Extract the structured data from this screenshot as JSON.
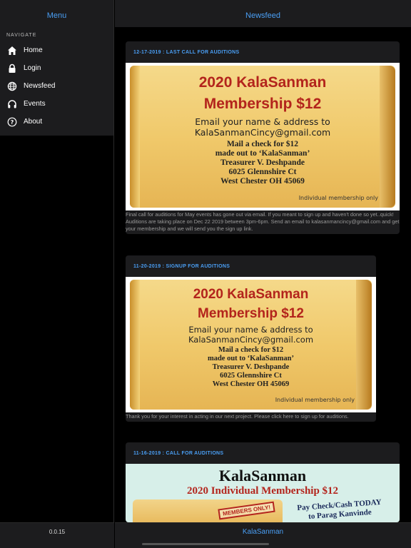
{
  "status_bar": {
    "left": "",
    "right": ""
  },
  "menu": {
    "title": "Menu",
    "nav_heading": "NAVIGATE",
    "items": [
      {
        "label": "Home",
        "icon": "home-icon"
      },
      {
        "label": "Login",
        "icon": "lock-icon"
      },
      {
        "label": "Newsfeed",
        "icon": "globe-icon"
      },
      {
        "label": "Events",
        "icon": "headphones-icon"
      },
      {
        "label": "About",
        "icon": "question-icon"
      }
    ],
    "version": "0.0.15"
  },
  "feed": {
    "title": "Newsfeed",
    "footer": "KalaSanman",
    "posts": [
      {
        "heading": "12-17-2019 : LAST CALL FOR AUDITIONS",
        "body": "Final call for auditions for May events has gone out via email. If you meant to sign up and haven't done so yet..quick! Auditions are taking place on Dec 22 2019 between 3pm-6pm. Send an email to kalasanmancincy@gmail.com and get your membership and we will send you the sign up link.",
        "poster": {
          "line1": "2020 KalaSanman",
          "line2": "Membership $12",
          "line3": "Email your name & address to",
          "line4": "KalaSanmanCincy@gmail.com",
          "line5": "Mail a check for $12",
          "line6": "made out to ‘KalaSanman’",
          "line7": "Treasurer V. Deshpande",
          "line8": "6025 Glennshire Ct",
          "line9": "West Chester OH 45069",
          "note": "Individual membership only"
        }
      },
      {
        "heading": "11-20-2019 : SIGNUP FOR AUDITIONS",
        "body": "Thank you for your interest in acting in our next project. Please click here to sign up for auditions.",
        "poster": {
          "line1": "2020 KalaSanman",
          "line2": "Membership $12",
          "line3": "Email your name & address to",
          "line4": "KalaSanmanCincy@gmail.com",
          "line5": "Mail a check for $12",
          "line6": "made out to ‘KalaSanman’",
          "line7": "Treasurer V. Deshpande",
          "line8": "6025 Glennshire Ct",
          "line9": "West Chester OH 45069",
          "note": "Individual membership only"
        }
      },
      {
        "heading": "11-16-2019 : CALL FOR AUDITIONS",
        "poster": {
          "name": "KalaSanman",
          "subtitle": "2020 Individual Membership $12",
          "stamp": "MEMBERS ONLY!",
          "pay1": "Pay Check/Cash TODAY",
          "pay2": "to Parag Kanvinde"
        }
      }
    ]
  },
  "colors": {
    "accent": "#4a9ff5",
    "panel": "#1c1c1e",
    "background": "#000000",
    "poster_red": "#b3241c"
  }
}
